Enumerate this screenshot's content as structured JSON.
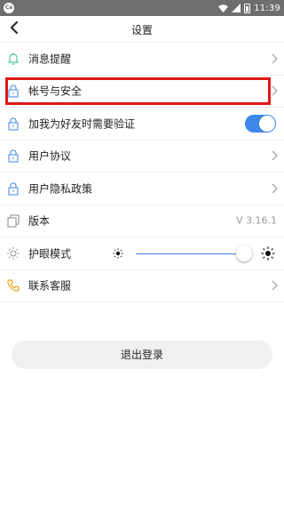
{
  "status_bar": {
    "time": "11:39",
    "left_icon_text": "Ca"
  },
  "header": {
    "title": "设置"
  },
  "rows": [
    {
      "label": "消息提醒"
    },
    {
      "label": "帐号与安全"
    },
    {
      "label": "加我为好友时需要验证",
      "toggle_on": true
    },
    {
      "label": "用户协议"
    },
    {
      "label": "用户隐私政策"
    },
    {
      "label": "版本",
      "value": "V 3.16.1"
    },
    {
      "label": "护眼模式",
      "brightness_level": 0.93
    },
    {
      "label": "联系客服"
    }
  ],
  "logout_label": "退出登录",
  "colors": {
    "accent": "#3d87e8",
    "highlight": "#e01818",
    "phone_icon": "#f0a020"
  }
}
